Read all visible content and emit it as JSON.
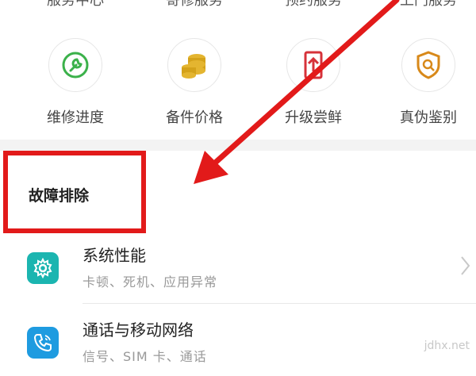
{
  "top_row": [
    "服务中心",
    "寄修服务",
    "预约服务",
    "上门服务"
  ],
  "services": [
    {
      "label": "维修进度",
      "icon": "wrench-icon",
      "color": "#3bb14a"
    },
    {
      "label": "备件价格",
      "icon": "coins-icon",
      "color": "#d4a21a"
    },
    {
      "label": "升级尝鲜",
      "icon": "upgrade-icon",
      "color": "#d6323a"
    },
    {
      "label": "真伪鉴别",
      "icon": "shield-search-icon",
      "color": "#d8891a"
    }
  ],
  "section": {
    "title": "故障排除"
  },
  "items": [
    {
      "title": "系统性能",
      "subtitle": "卡顿、死机、应用异常",
      "icon": "gear-icon",
      "color": "#1bb5b0"
    },
    {
      "title": "通话与移动网络",
      "subtitle": "信号、SIM 卡、通话",
      "icon": "phone-icon",
      "color": "#1e9be0"
    }
  ],
  "annotation": {
    "color": "#e21a1a"
  },
  "watermark": "jdhx.net"
}
